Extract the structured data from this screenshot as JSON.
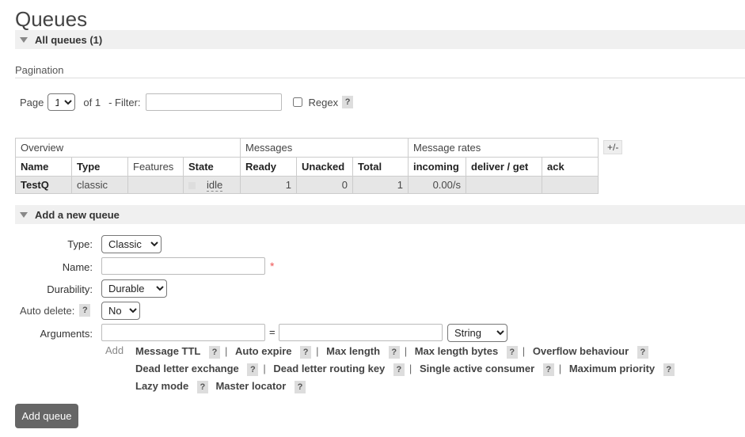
{
  "page": {
    "title": "Queues"
  },
  "all_queues": {
    "label": "All queues (1)"
  },
  "pagination": {
    "label": "Pagination",
    "page_label": "Page",
    "page_value": "1",
    "of_label": "of 1",
    "filter_label": "- Filter:",
    "filter_value": "",
    "regex_label": "Regex",
    "help": "?"
  },
  "table": {
    "groups": [
      "Overview",
      "Messages",
      "Message rates"
    ],
    "columns": [
      "Name",
      "Type",
      "Features",
      "State",
      "Ready",
      "Unacked",
      "Total",
      "incoming",
      "deliver / get",
      "ack"
    ],
    "rows": [
      {
        "name": "TestQ",
        "type": "classic",
        "features": "",
        "state": "idle",
        "ready": "1",
        "unacked": "0",
        "total": "1",
        "incoming": "0.00/s",
        "deliver_get": "",
        "ack": ""
      }
    ],
    "toggle": "+/-"
  },
  "add_queue": {
    "section_label": "Add a new queue",
    "type_label": "Type:",
    "type_value": "Classic",
    "name_label": "Name:",
    "name_value": "",
    "required_mark": "*",
    "durability_label": "Durability:",
    "durability_value": "Durable",
    "auto_delete_label": "Auto delete:",
    "auto_delete_value": "No",
    "arguments_label": "Arguments:",
    "equals": "=",
    "arg_type_value": "String",
    "add_label": "Add",
    "arg_links": [
      [
        "Message TTL",
        "Auto expire",
        "Max length",
        "Max length bytes",
        "Overflow behaviour"
      ],
      [
        "Dead letter exchange",
        "Dead letter routing key",
        "Single active consumer",
        "Maximum priority"
      ],
      [
        "Lazy mode",
        "Master locator"
      ]
    ],
    "help": "?",
    "separator": "|",
    "submit_label": "Add queue"
  }
}
